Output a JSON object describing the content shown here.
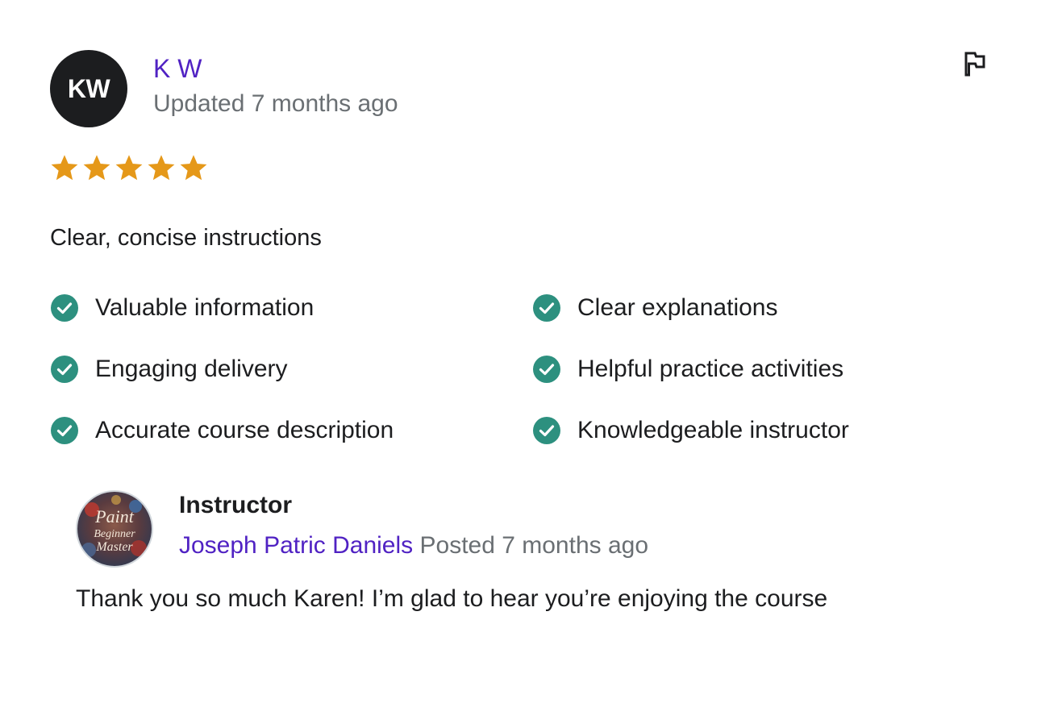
{
  "review": {
    "avatar_initials": "KW",
    "reviewer_name": "K W",
    "updated": "Updated 7 months ago",
    "rating": 5,
    "max_rating": 5,
    "text": "Clear, concise instructions",
    "feedback": [
      {
        "label": "Valuable information"
      },
      {
        "label": "Clear explanations"
      },
      {
        "label": "Engaging delivery"
      },
      {
        "label": "Helpful practice activities"
      },
      {
        "label": "Accurate course description"
      },
      {
        "label": "Knowledgeable instructor"
      }
    ],
    "icons": {
      "report": "flag-icon",
      "star": "star-icon",
      "check": "check-circle-icon"
    }
  },
  "instructor_response": {
    "role": "Instructor",
    "name": "Joseph Patric Daniels",
    "posted": "Posted 7 months ago",
    "text": "Thank you so much Karen! I’m glad to hear you’re enjoying the course",
    "avatar_logo_text": [
      "Paint",
      "Beginner",
      "Master"
    ]
  },
  "colors": {
    "star": "#e59819",
    "check": "#2d907f",
    "link": "#5022c3",
    "muted": "#6a6f73",
    "text": "#1c1d1f",
    "avatar_bg": "#1c1d1f"
  }
}
